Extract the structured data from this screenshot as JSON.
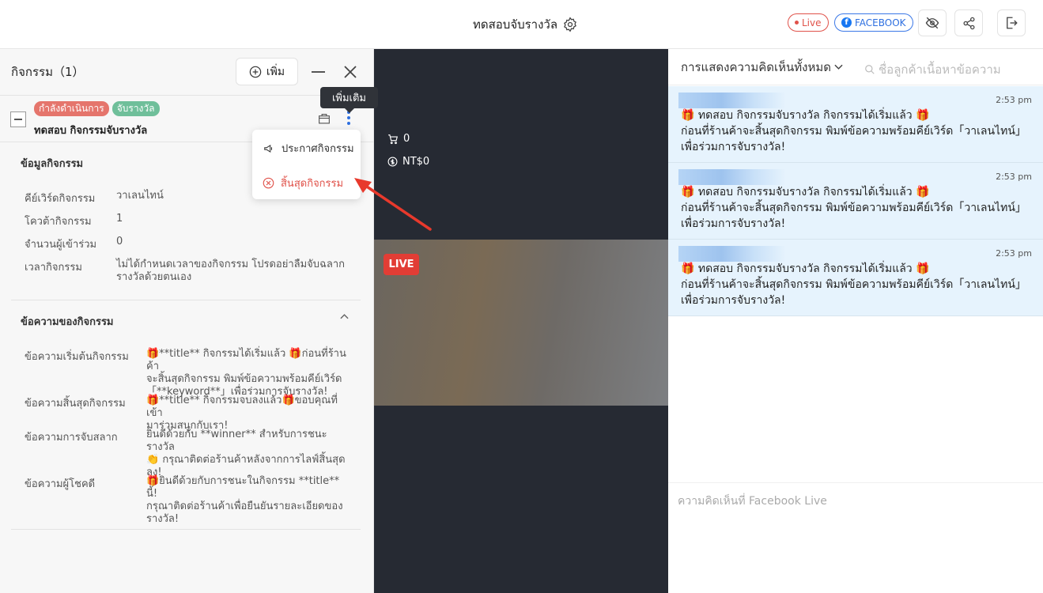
{
  "topbar": {
    "title": "ทดสอบจับรางวัล",
    "live_label": "Live",
    "facebook_label": "FACEBOOK"
  },
  "left_panel": {
    "title": "กิจกรรม（1）",
    "add_label": "เพิ่ม",
    "tags": [
      {
        "label": "กำลังดำเนินการ",
        "color": "#e5756c"
      },
      {
        "label": "จับรางวัล",
        "color": "#6fbf9a"
      }
    ],
    "activity_name": "ทดสอบ กิจกรรมจับรางวัล",
    "info_section_title": "ข้อมูลกิจกรรม",
    "info": [
      {
        "label": "คีย์เวิร์ดกิจกรรม",
        "value": "วาเลนไทน์"
      },
      {
        "label": "โควต้ากิจกรรม",
        "value": "1"
      },
      {
        "label": "จำนวนผู้เข้าร่วม",
        "value": "0"
      },
      {
        "label": "เวลากิจกรรม",
        "value": "ไม่ได้กำหนดเวลาของกิจกรรม โปรดอย่าลืมจับฉลาก\nรางวัลด้วยตนเอง"
      }
    ],
    "messages_section_title": "ข้อความของกิจกรรม",
    "messages": [
      {
        "label": "ข้อความเริ่มต้นกิจกรรม",
        "value": "🎁**title** กิจกรรมได้เริ่มแล้ว 🎁ก่อนที่ร้านค้า\nจะสิ้นสุดกิจกรรม พิมพ์ข้อความพร้อมคีย์เวิร์ด\n「**keyword**」เพื่อร่วมการจับรางวัล!"
      },
      {
        "label": "ข้อความสิ้นสุดกิจกรรม",
        "value": "🎁**title** กิจกรรมจบลงแล้ว🎁ขอบคุณที่เข้า\nมาร่วมสนุกกับเรา!"
      },
      {
        "label": "ข้อความการจับสลาก",
        "value": "ยินดีด้วยกับ **winner** สำหรับการชนะรางวัล\n👏 กรุณาติดต่อร้านค้าหลังจากการไลฟ์สิ้นสุด\nลง!"
      },
      {
        "label": "ข้อความผู้โชคดี",
        "value": "🎁ยินดีด้วยกับการชนะในกิจกรรม **title** นี้!\nกรุณาติดต่อร้านค้าเพื่อยืนยันรายละเอียดของ\nรางวัล!"
      }
    ]
  },
  "tooltip": "เพิ่มเติม",
  "menu": {
    "announce": "ประกาศกิจกรรม",
    "end": "สิ้นสุดกิจกรรม"
  },
  "video": {
    "cart_count": "0",
    "revenue": "NT$0",
    "live_badge": "LIVE"
  },
  "comments_panel": {
    "filter_label": "การแสดงความคิดเห็นทั้งหมด",
    "search_placeholder": "ชื่อลูกค้าเนื้อหาข้อความ",
    "comments": [
      {
        "time": "2:53 pm",
        "text": "🎁 ทดสอบ กิจกรรมจับรางวัล กิจกรรมได้เริ่มแล้ว 🎁\nก่อนที่ร้านค้าจะสิ้นสุดกิจกรรม พิมพ์ข้อความพร้อมคีย์เวิร์ด「วาเลนไทน์」เพื่อร่วมการจับรางวัล!"
      },
      {
        "time": "2:53 pm",
        "text": "🎁 ทดสอบ กิจกรรมจับรางวัล กิจกรรมได้เริ่มแล้ว 🎁\nก่อนที่ร้านค้าจะสิ้นสุดกิจกรรม พิมพ์ข้อความพร้อมคีย์เวิร์ด「วาเลนไทน์」เพื่อร่วมการจับรางวัล!"
      },
      {
        "time": "2:53 pm",
        "text": "🎁 ทดสอบ กิจกรรมจับรางวัล กิจกรรมได้เริ่มแล้ว 🎁\nก่อนที่ร้านค้าจะสิ้นสุดกิจกรรม พิมพ์ข้อความพร้อมคีย์เวิร์ด「วาเลนไทน์」เพื่อร่วมการจับรางวัล!"
      }
    ],
    "input_placeholder": "ความคิดเห็นที่ Facebook Live"
  },
  "colors": {
    "accent_red": "#e0524a",
    "facebook_blue": "#1877f2",
    "comment_bg": "#e6f3fd",
    "video_bg": "#262a33"
  }
}
